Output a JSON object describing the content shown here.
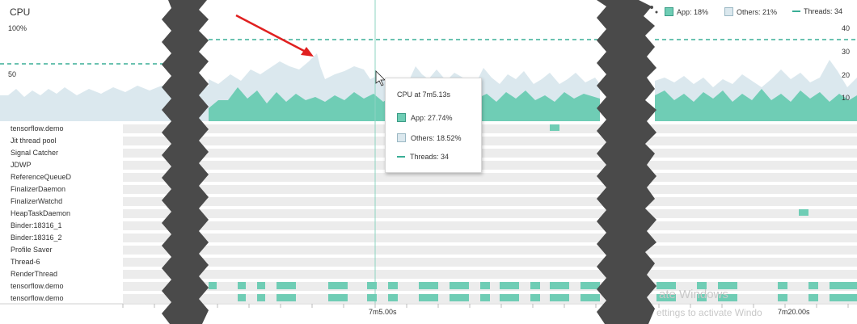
{
  "cpu_panel": {
    "title": "CPU",
    "y_axis_left": [
      "100%",
      "50"
    ],
    "y_axis_right": [
      "40",
      "30",
      "20",
      "10"
    ]
  },
  "legend": {
    "app": "App: 18%",
    "others": "Others: 21%",
    "threads": "Threads: 34"
  },
  "tooltip": {
    "title": "CPU at 7m5.13s",
    "app": "App: 27.74%",
    "others": "Others: 18.52%",
    "threads": "Threads: 34"
  },
  "threads": [
    "tensorflow.demo",
    "Jit thread pool",
    "Signal Catcher",
    "JDWP",
    "ReferenceQueueD",
    "FinalizerDaemon",
    "FinalizerWatchd",
    "HeapTaskDaemon",
    "Binder:18316_1",
    "Binder:18316_2",
    "Profile Saver",
    "Thread-6",
    "RenderThread",
    "tensorflow.demo",
    "tensorflow.demo"
  ],
  "timeline": {
    "labels": [
      "7m5.00s",
      "7m20.00s"
    ]
  },
  "watermark": {
    "line1": "ate Windows",
    "line2": "ettings to activate Windo"
  },
  "colors": {
    "app": "#6fcdb5",
    "others": "#dbe8ee",
    "threads_dash": "#3aae96",
    "annotation_arrow": "#e02020",
    "tear": "#4a4a4a"
  },
  "icons": [
    "mouse-cursor-icon",
    "red-arrow-annotation"
  ]
}
